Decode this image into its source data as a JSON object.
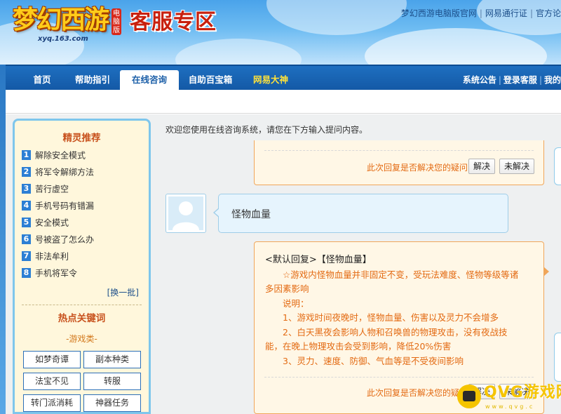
{
  "banner": {
    "logo_text": "梦幻西游",
    "logo_url": "xyq.163.com",
    "pc_tag": "电脑版",
    "title": "客服专区"
  },
  "top_links": [
    {
      "label": "梦幻西游电脑版官网"
    },
    {
      "label": "网易通行证"
    },
    {
      "label": "官方论"
    }
  ],
  "nav": {
    "tabs": [
      {
        "label": "首页",
        "active": false
      },
      {
        "label": "帮助指引",
        "active": false
      },
      {
        "label": "在线咨询",
        "active": true
      },
      {
        "label": "自助百宝箱",
        "active": false
      },
      {
        "label": "网易大神",
        "active": false,
        "color": "#ffe23a"
      }
    ],
    "right_links": [
      {
        "label": "系统公告"
      },
      {
        "label": "登录客服"
      },
      {
        "label": "我的"
      }
    ]
  },
  "sidebar": {
    "title": "精灵推荐",
    "items": [
      {
        "num": "1",
        "label": "解除安全模式"
      },
      {
        "num": "2",
        "label": "将军令解绑方法"
      },
      {
        "num": "3",
        "label": "苦行虚空"
      },
      {
        "num": "4",
        "label": "手机号码有错漏"
      },
      {
        "num": "5",
        "label": "安全模式"
      },
      {
        "num": "6",
        "label": "号被盗了怎么办"
      },
      {
        "num": "7",
        "label": "非法牟利"
      },
      {
        "num": "8",
        "label": "手机将军令"
      }
    ],
    "swap_label": "[换一批]",
    "hot_title": "热点关键词",
    "category": "-游戏类-",
    "keywords": [
      "如梦奇谭",
      "副本种类",
      "法宝不见",
      "转服",
      "转门派消耗",
      "神器任务"
    ]
  },
  "chat": {
    "welcome": "欢迎您使用在线咨询系统，请您在下方输入提问内容。",
    "resolve_question": "此次回复是否解决您的疑问：",
    "btn_resolved": "解决",
    "btn_unresolved": "未解决",
    "user_message": "怪物血量",
    "reply": {
      "heading": "<默认回复>【怪物血量】",
      "lines": [
        "☆游戏内怪物血量并非固定不变，受玩法难度、怪物等级等诸",
        "多因素影响",
        "说明：",
        "1、游戏时间夜晚时，怪物血量、伤害以及灵力不会增多",
        "2、白天黑夜会影响人物和召唤兽的物理攻击，没有夜战技",
        "能，在晚上物理攻击会受到影响，降低20%伤害",
        "3、灵力、速度、防御、气血等是不受夜间影响"
      ]
    }
  },
  "watermark": {
    "text": "QVG游戏网",
    "sub": "www.qvg.c"
  }
}
